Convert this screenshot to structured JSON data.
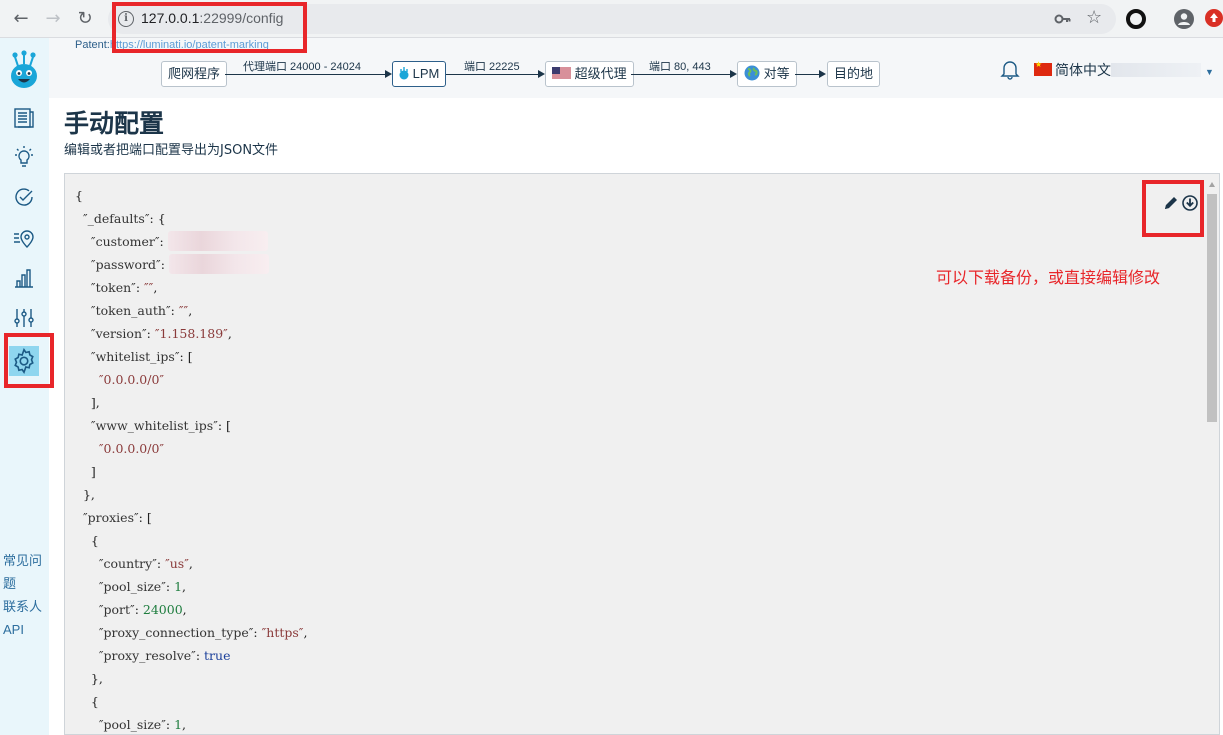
{
  "browser": {
    "url_host": "127.0.0.1",
    "url_rest": ":22999/config"
  },
  "topbar": {
    "patent_label": "Patent:",
    "patent_link": "https://luminati.io/patent-marking",
    "nodes": [
      "爬网程序",
      "LPM",
      "超级代理",
      "对等",
      "目的地"
    ],
    "edge_labels": [
      "代理端口 24000 - 24024",
      "端口 22225",
      "端口 80, 443"
    ],
    "language": "简体中文"
  },
  "sidebar": {
    "links": [
      "常见问",
      "题",
      "联系人",
      "API"
    ]
  },
  "page": {
    "title": "手动配置",
    "subtitle": "编辑或者把端口配置导出为JSON文件",
    "annotation": "可以下载备份，或直接编辑修改"
  },
  "config_json": {
    "lines": [
      "{",
      "  ″_defaults″: {",
      "    ″customer″: ",
      "    ″password″: ",
      "    ″token″: ″″,",
      "    ″token_auth″: ″″,",
      "    ″version″: ″1.158.189″,",
      "    ″whitelist_ips″: [",
      "      ″0.0.0.0/0″",
      "    ],",
      "    ″www_whitelist_ips″: [",
      "      ″0.0.0.0/0″",
      "    ]",
      "  },",
      "  ″proxies″: [",
      "    {",
      "      ″country″: ″us″,",
      "      ″pool_size″: 1,",
      "      ″port″: 24000,",
      "      ″proxy_connection_type″: ″https″,",
      "      ″proxy_resolve″: true",
      "    },",
      "    {",
      "      ″pool_size″: 1,"
    ]
  },
  "colors": {
    "brand_dark": "#1c3549",
    "sidebar_bg": "#e9f6fb",
    "highlight_red": "#e8262a"
  }
}
